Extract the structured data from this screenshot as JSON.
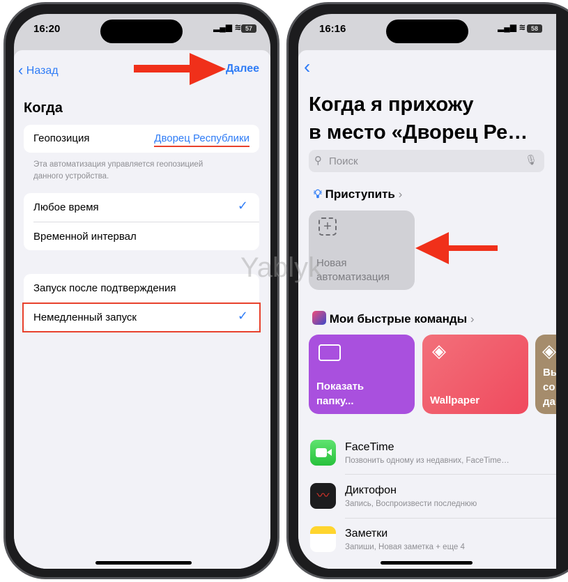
{
  "left": {
    "status": {
      "time": "16:20",
      "battery": "57"
    },
    "nav": {
      "back": "Назад",
      "next": "Далее"
    },
    "section_title": "Когда",
    "location": {
      "label": "Геопозиция",
      "value": "Дворец Республики"
    },
    "footnote_1": "Эта автоматизация управляется геопозицией",
    "footnote_2": "данного устройства.",
    "time_options": [
      "Любое время",
      "Временной интервал"
    ],
    "run_options": [
      "Запуск после подтверждения",
      "Немедленный запуск"
    ],
    "accent": "#2f7cf6",
    "highlight": "#e8412c"
  },
  "right": {
    "status": {
      "time": "16:16",
      "battery": "58"
    },
    "title_1": "Когда я прихожу",
    "title_2": "в место «Дворец Ре…",
    "search_placeholder": "Поиск",
    "get_started": "Приступить",
    "new_automation_1": "Новая",
    "new_automation_2": "автоматизация",
    "my_shortcuts": "Мои быстрые команды",
    "shortcuts": [
      {
        "line1": "Показать",
        "line2": "папку...",
        "color": "#a950de",
        "icon": "folder-icon"
      },
      {
        "line1": "Wallpaper",
        "color": "#f25a6a",
        "icon": "layers-icon"
      },
      {
        "line1": "Вы",
        "line2": "со",
        "line3": "да",
        "color": "#a58c6c",
        "icon": "layers-icon"
      }
    ],
    "apps": [
      {
        "name": "FaceTime",
        "sub": "Позвонить одному из недавних, FaceTime…"
      },
      {
        "name": "Диктофон",
        "sub": "Запись, Воспроизвести последнюю"
      },
      {
        "name": "Заметки",
        "sub": "Запиши, Новая заметка + еще 4"
      }
    ]
  },
  "watermark": "Yablyk"
}
